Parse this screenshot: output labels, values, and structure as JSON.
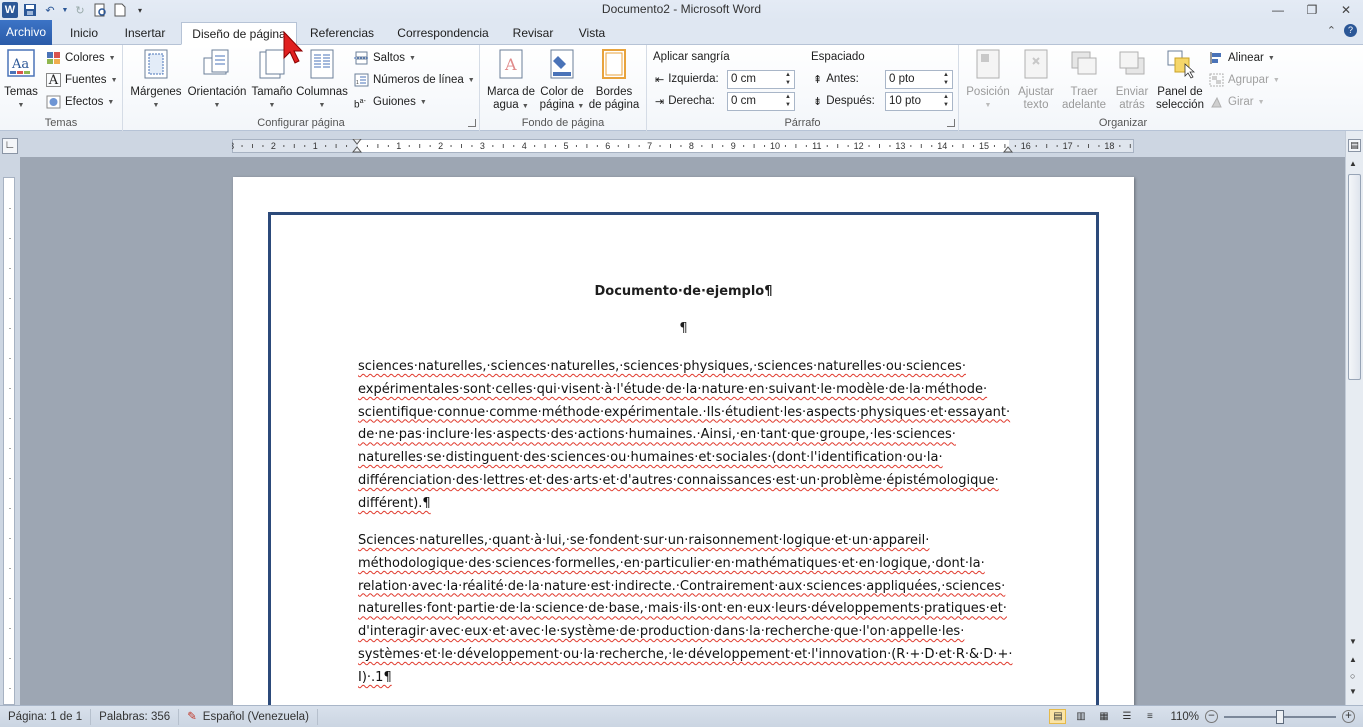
{
  "window": {
    "title": "Documento2  -  Microsoft Word",
    "controls": [
      "minimize",
      "restore",
      "close"
    ]
  },
  "tabs": [
    {
      "label": "Archivo"
    },
    {
      "label": "Inicio"
    },
    {
      "label": "Insertar"
    },
    {
      "label": "Diseño de página"
    },
    {
      "label": "Referencias"
    },
    {
      "label": "Correspondencia"
    },
    {
      "label": "Revisar"
    },
    {
      "label": "Vista"
    }
  ],
  "active_tab": "Diseño de página",
  "ribbon": {
    "temas": {
      "label": "Temas",
      "temas_btn": "Temas",
      "colores": "Colores",
      "fuentes": "Fuentes",
      "efectos": "Efectos"
    },
    "configurar": {
      "label": "Configurar página",
      "margenes": "Márgenes",
      "orientacion": "Orientación",
      "tamano": "Tamaño",
      "columnas": "Columnas",
      "saltos": "Saltos",
      "numeros": "Números de línea",
      "guiones": "Guiones"
    },
    "fondo": {
      "label": "Fondo de página",
      "marca_1": "Marca de",
      "marca_2": "agua",
      "color_1": "Color de",
      "color_2": "página",
      "bordes_1": "Bordes",
      "bordes_2": "de página"
    },
    "parrafo": {
      "label": "Párrafo",
      "sangria_title": "Aplicar sangría",
      "izquierda_label": "Izquierda:",
      "izquierda_value": "0 cm",
      "derecha_label": "Derecha:",
      "derecha_value": "0 cm",
      "espaciado_title": "Espaciado",
      "antes_label": "Antes:",
      "antes_value": "0 pto",
      "despues_label": "Después:",
      "despues_value": "10 pto"
    },
    "organizar": {
      "label": "Organizar",
      "posicion": "Posición",
      "ajustar_1": "Ajustar",
      "ajustar_2": "texto",
      "traer_1": "Traer",
      "traer_2": "adelante",
      "enviar_1": "Enviar",
      "enviar_2": "atrás",
      "panel_1": "Panel de",
      "panel_2": "selección",
      "alinear": "Alinear",
      "agrupar": "Agrupar",
      "girar": "Girar"
    }
  },
  "ruler": {
    "numbers": [
      "3",
      "2",
      "1",
      "1",
      "2",
      "3",
      "4",
      "5",
      "6",
      "7",
      "8",
      "9",
      "10",
      "11",
      "12",
      "13",
      "14",
      "15",
      "16",
      "17",
      "18"
    ]
  },
  "document": {
    "title": "Documento·de·ejemplo¶",
    "blank": "¶",
    "p1": [
      "sciences·naturelles,·sciences·naturelles,·sciences·physiques,·sciences·naturelles·ou·sciences·",
      "expérimentales·sont·celles·qui·visent·à·l'étude·de·la·nature·en·suivant·le·modèle·de·la·méthode·",
      "scientifique·connue·comme·méthode·expérimentale.·Ils·étudient·les·aspects·physiques·et·essayant·",
      "de·ne·pas·inclure·les·aspects·des·actions·humaines.·Ainsi,·en·tant·que·groupe,·les·sciences·",
      "naturelles·se·distinguent·des·sciences·ou·humaines·et·sociales·(dont·l'identification·ou·la·",
      "différenciation·des·lettres·et·des·arts·et·d'autres·connaissances·est·un·problème·épistémologique·",
      "différent).¶"
    ],
    "p2": [
      "Sciences·naturelles,·quant·à·lui,·se·fondent·sur·un·raisonnement·logique·et·un·appareil·",
      "méthodologique·des·sciences·formelles,·en·particulier·en·mathématiques·et·en·logique,·dont·la·",
      "relation·avec·la·réalité·de·la·nature·est·indirecte.·Contrairement·aux·sciences·appliquées,·sciences·",
      "naturelles·font·partie·de·la·science·de·base,·mais·ils·ont·en·eux·leurs·développements·pratiques·et·",
      "d'interagir·avec·eux·et·avec·le·système·de·production·dans·la·recherche·que·l'on·appelle·les·",
      "systèmes·et·le·développement·ou·la·recherche,·le·développement·et·l'innovation·(R·+·D·et·R·&·D·+·",
      "I)·.1¶"
    ]
  },
  "status": {
    "page": "Página: 1 de 1",
    "words": "Palabras: 356",
    "language": "Español (Venezuela)",
    "zoom": "110%",
    "zoom_slider_fraction": 0.5
  },
  "colors": {
    "file_tab": "#2a5ba8",
    "page_border": "#2c4a7a",
    "spell_underline": "#e0392c",
    "cursor": "#e02020"
  }
}
